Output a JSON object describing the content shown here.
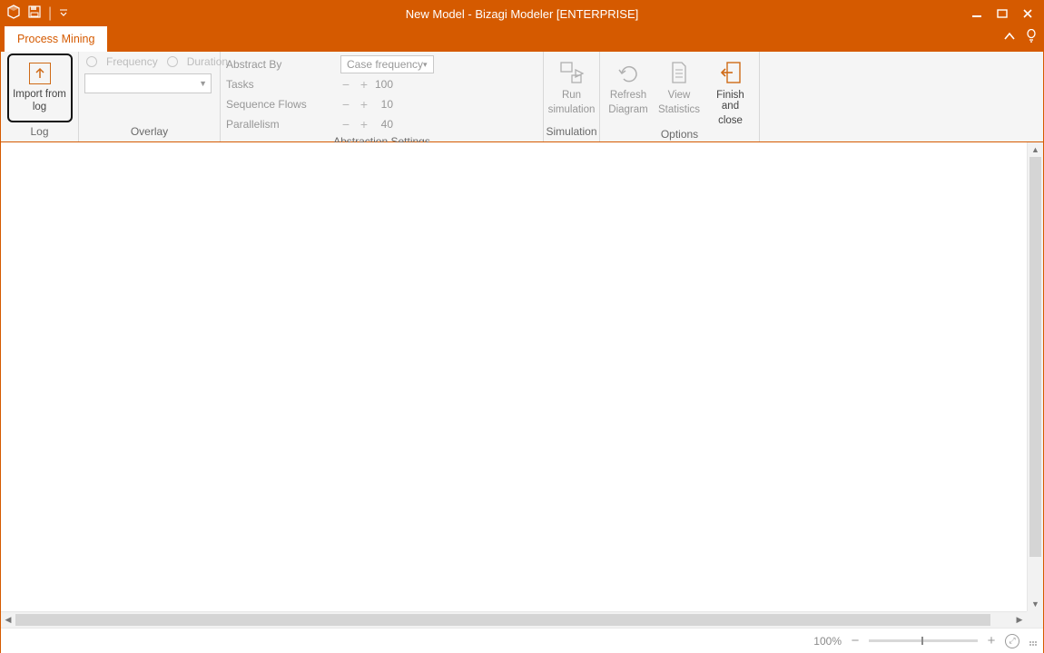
{
  "window": {
    "title": "New Model - Bizagi Modeler [ENTERPRISE]"
  },
  "tabs": {
    "process_mining": "Process Mining"
  },
  "ribbon": {
    "log": {
      "import_label1": "Import from",
      "import_label2": "log",
      "group_label": "Log"
    },
    "overlay": {
      "radio_frequency": "Frequency",
      "radio_duration": "Duration",
      "group_label": "Overlay"
    },
    "abstraction": {
      "abstract_by_label": "Abstract By",
      "abstract_by_value": "Case frequency",
      "tasks_label": "Tasks",
      "tasks_value": "100",
      "sequence_label": "Sequence Flows",
      "sequence_value": "10",
      "parallelism_label": "Parallelism",
      "parallelism_value": "40",
      "group_label": "Abstraction Settings"
    },
    "simulation": {
      "run_label1": "Run",
      "run_label2": "simulation",
      "group_label": "Simulation"
    },
    "options": {
      "refresh_label1": "Refresh",
      "refresh_label2": "Diagram",
      "view_label1": "View",
      "view_label2": "Statistics",
      "finish_label1": "Finish and",
      "finish_label2": "close",
      "group_label": "Options"
    }
  },
  "statusbar": {
    "zoom": "100%"
  }
}
